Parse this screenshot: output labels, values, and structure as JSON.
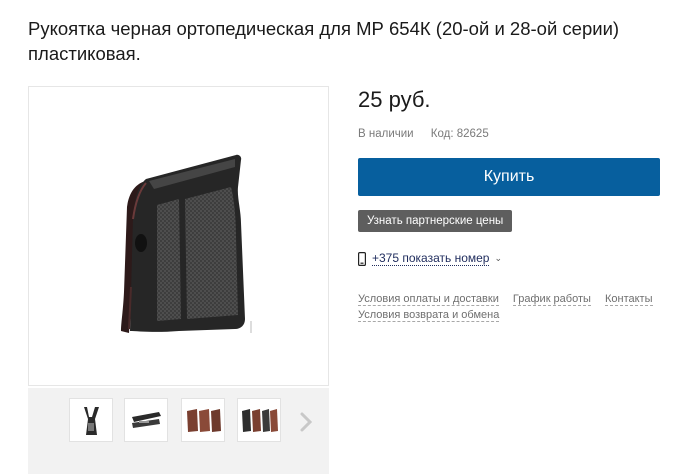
{
  "product": {
    "title_line1": "Рукоятка черная ортопедическая для МР 654К (20-ой и 28-ой серии)",
    "title_line2": "пластиковая.",
    "price": "25 руб.",
    "availability": "В наличии",
    "code": "Код: 82625"
  },
  "actions": {
    "buy_label": "Купить",
    "partner_prices_label": "Узнать партнерские цены"
  },
  "phone": {
    "label": "+375 показать номер",
    "icon": "mobile-phone-icon"
  },
  "links": {
    "payment_delivery": "Условия оплаты и доставки",
    "schedule": "График работы",
    "contacts": "Контакты",
    "returns": "Условия возврата и обмена"
  },
  "gallery": {
    "thumbnail_count": 4,
    "next_icon": "chevron-right-icon"
  },
  "colors": {
    "buy_button": "#075f9e",
    "partner_button": "#5e5e5e",
    "thumb_strip": "#f2f2f2"
  }
}
